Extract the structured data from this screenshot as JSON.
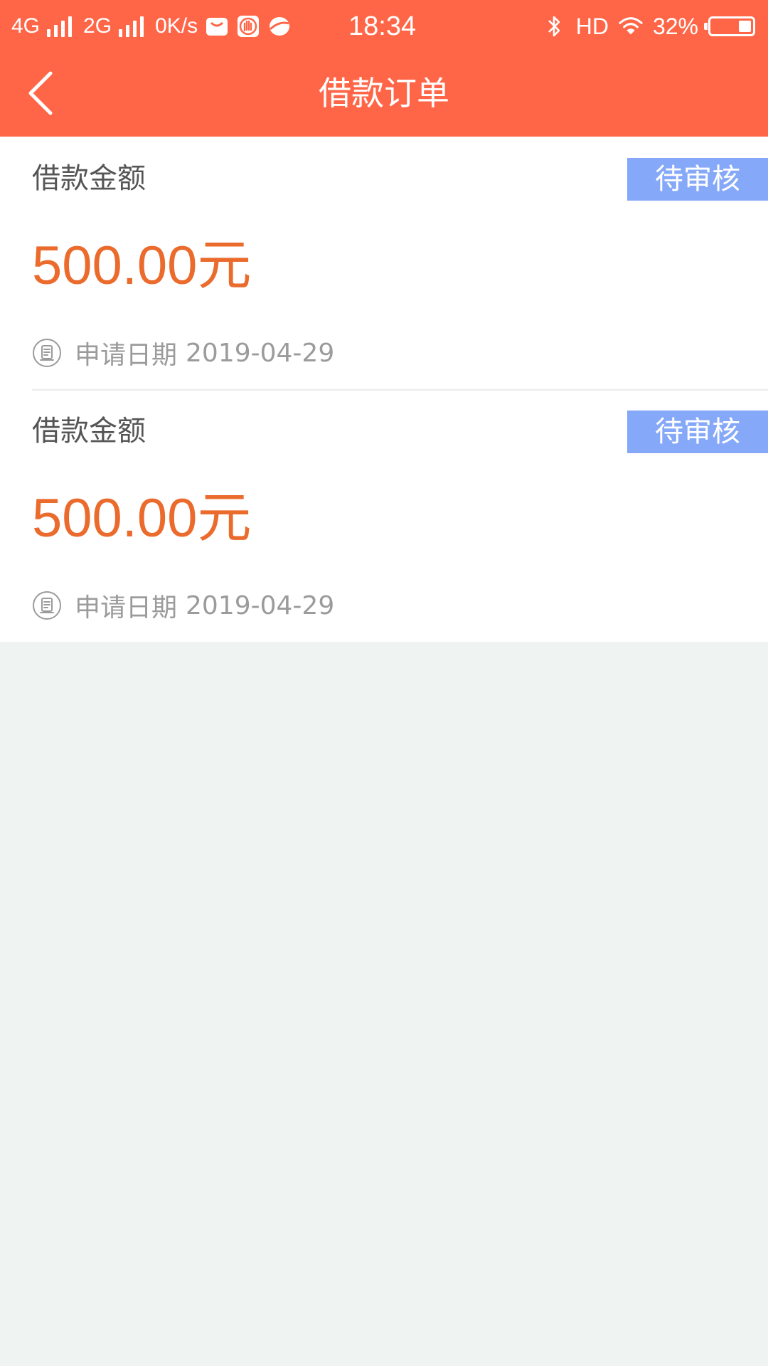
{
  "status_bar": {
    "network1": "4G",
    "network2": "2G",
    "speed": "0K/s",
    "time": "18:34",
    "hd": "HD",
    "battery_text": "32%",
    "battery_level": 0.32,
    "icons": [
      "message-icon",
      "hand-icon",
      "browser-icon",
      "bluetooth-icon",
      "wifi-icon",
      "battery-icon"
    ]
  },
  "header": {
    "title": "借款订单",
    "back_icon": "chevron-left-icon"
  },
  "orders": [
    {
      "amount_label": "借款金额",
      "status": "待审核",
      "amount": "500.00元",
      "date_label": "申请日期",
      "date": "2019-04-29"
    },
    {
      "amount_label": "借款金额",
      "status": "待审核",
      "amount": "500.00元",
      "date_label": "申请日期",
      "date": "2019-04-29"
    }
  ],
  "colors": {
    "header_bg": "#ff6648",
    "amount": "#eb6b2d",
    "badge_bg": "#85a8f8",
    "page_bg": "#eff3f2"
  }
}
